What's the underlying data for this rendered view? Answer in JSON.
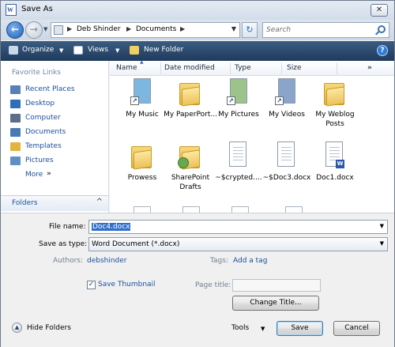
{
  "window": {
    "title": "Save As"
  },
  "address": {
    "crumbs": [
      "Deb Shinder",
      "Documents"
    ]
  },
  "search": {
    "placeholder": "Search"
  },
  "toolbar": {
    "organize": "Organize",
    "views": "Views",
    "new_folder": "New Folder"
  },
  "favorites": {
    "heading": "Favorite Links",
    "items": [
      {
        "label": "Recent Places",
        "icon": "recent-places-icon",
        "color": "#5a7fb8"
      },
      {
        "label": "Desktop",
        "icon": "desktop-icon",
        "color": "#2f6fb5"
      },
      {
        "label": "Computer",
        "icon": "computer-icon",
        "color": "#5c6f86"
      },
      {
        "label": "Documents",
        "icon": "documents-icon",
        "color": "#4a7ab3"
      },
      {
        "label": "Templates",
        "icon": "folder-icon",
        "color": "#e2b33e"
      },
      {
        "label": "Pictures",
        "icon": "pictures-icon",
        "color": "#5f8fc4"
      }
    ],
    "more": "More",
    "more_chevron": "»"
  },
  "folders_bar": {
    "label": "Folders",
    "chevron": "^"
  },
  "columns": [
    "Name",
    "Date modified",
    "Type",
    "Size"
  ],
  "columns_more": "»",
  "files": [
    {
      "label": "My Music",
      "kind": "shortcut",
      "tint": "#7db7e0"
    },
    {
      "label": "My PaperPort...",
      "kind": "folder"
    },
    {
      "label": "My Pictures",
      "kind": "shortcut",
      "tint": "#9cc48a"
    },
    {
      "label": "My Videos",
      "kind": "shortcut",
      "tint": "#8aa5c9"
    },
    {
      "label": "My Weblog Posts",
      "kind": "folder"
    },
    {
      "label": "Prowess",
      "kind": "folder"
    },
    {
      "label": "SharePoint Drafts",
      "kind": "folder-special"
    },
    {
      "label": "~$crypted....",
      "kind": "doc"
    },
    {
      "label": "~$Doc3.docx",
      "kind": "doc"
    },
    {
      "label": "Doc1.docx",
      "kind": "docx"
    }
  ],
  "form": {
    "file_name_label": "File name:",
    "file_name_value": "Doc4.docx",
    "save_type_label": "Save as type:",
    "save_type_value": "Word Document (*.docx)",
    "authors_label": "Authors:",
    "authors_value": "debshinder",
    "tags_label": "Tags:",
    "tags_value": "Add a tag",
    "thumbnail_label": "Save Thumbnail",
    "thumbnail_checked": true,
    "thumbnail_check": "✓",
    "page_title_label": "Page title:",
    "change_title": "Change Title..."
  },
  "bottom": {
    "hide_folders": "Hide Folders",
    "tools": "Tools",
    "save": "Save",
    "cancel": "Cancel"
  }
}
